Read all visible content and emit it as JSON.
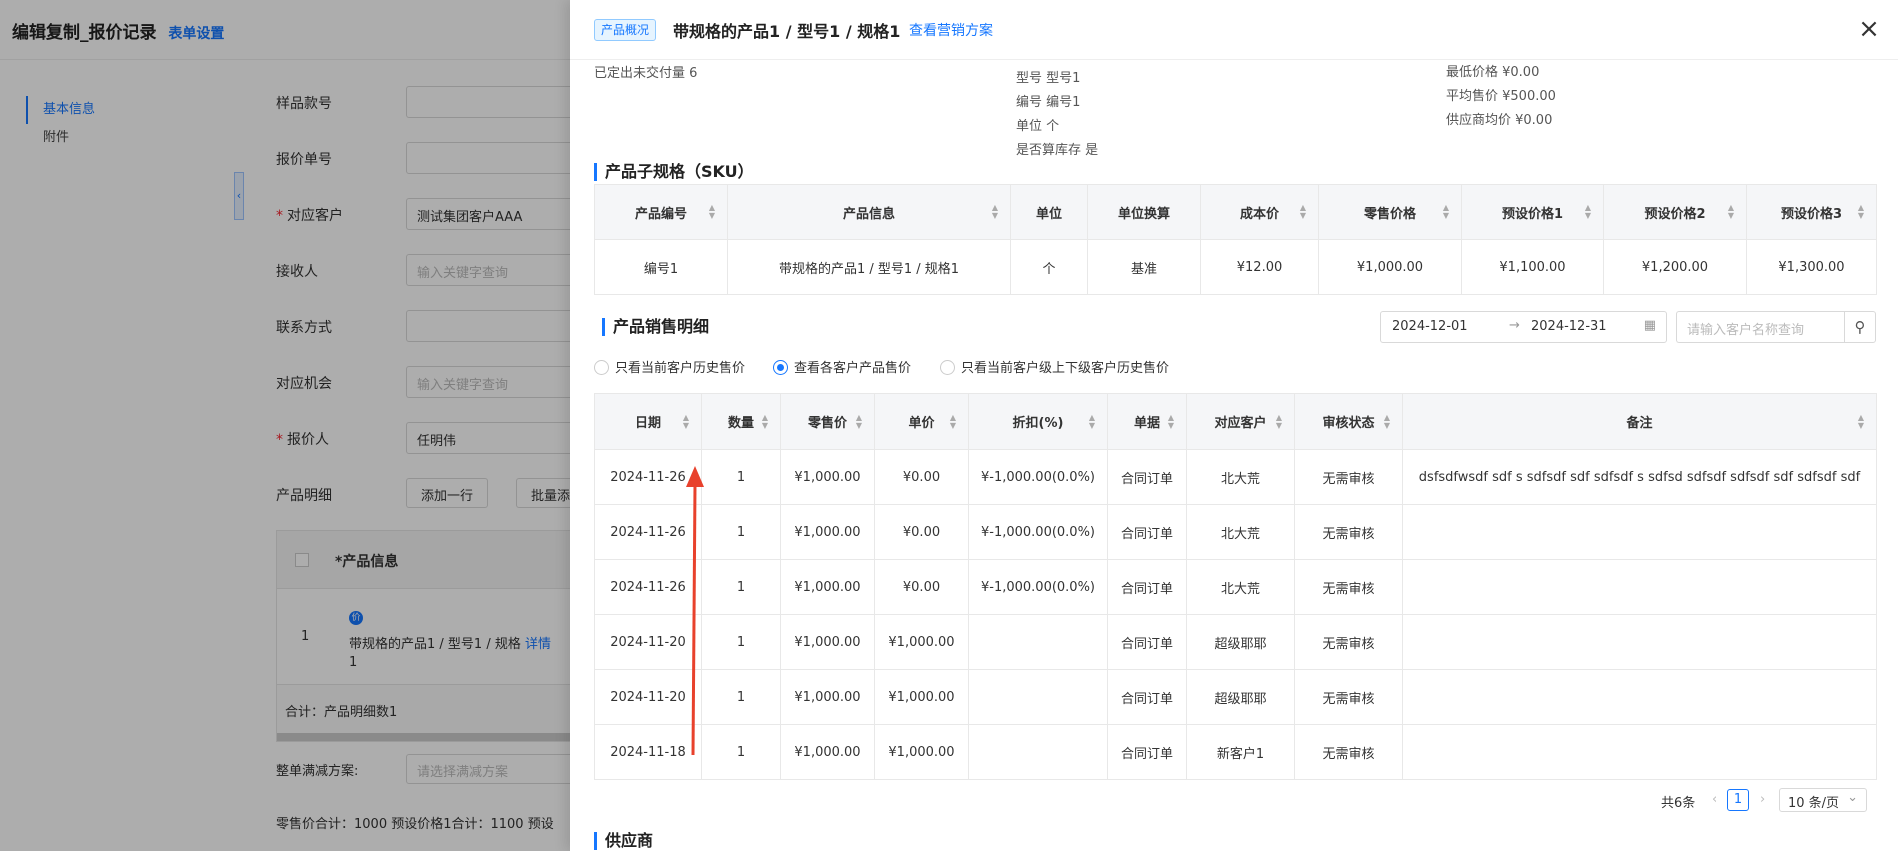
{
  "bg": {
    "title": "编辑复制_报价记录",
    "setting": "表单设置",
    "nav": [
      "基本信息",
      "附件"
    ],
    "collapse_glyph": "‹",
    "fields": [
      {
        "label": "样品款号",
        "required": false,
        "value": "",
        "placeholder": ""
      },
      {
        "label": "报价单号",
        "required": false,
        "value": "",
        "placeholder": ""
      },
      {
        "label": "对应客户",
        "required": true,
        "value": "测试集团客户AAA",
        "placeholder": ""
      },
      {
        "label": "接收人",
        "required": false,
        "value": "",
        "placeholder": "输入关键字查询"
      },
      {
        "label": "联系方式",
        "required": false,
        "value": "",
        "placeholder": ""
      },
      {
        "label": "对应机会",
        "required": false,
        "value": "",
        "placeholder": "输入关键字查询"
      },
      {
        "label": "报价人",
        "required": true,
        "value": "任明伟",
        "placeholder": ""
      }
    ],
    "required_mark": "*",
    "product_detail_label": "产品明细",
    "add_row": "添加一行",
    "batch_add": "批量添加",
    "table_header": "*产品信息",
    "row_no": "1",
    "price_badge": "价",
    "row_product": "带规格的产品1 / 型号1 / 规格",
    "row_detail_link": "详情",
    "row_qty": "1",
    "sum_text": "合计：产品明细数1",
    "discount_label": "整单满减方案:",
    "discount_placeholder": "请选择满减方案",
    "totals": "零售价合计：1000  预设价格1合计：1100  预设"
  },
  "drawer": {
    "tag": "产品概况",
    "title": "带规格的产品1 / 型号1 / 规格1",
    "marketing_link": "查看营销方案",
    "close_glyph": "×",
    "info": {
      "undelivered": "已定出未交付量  6",
      "model": "型号 型号1",
      "code": "编号 编号1",
      "unit": "单位 个",
      "stock": "是否算库存 是",
      "min_price": "最低价格 ¥0.00",
      "avg_price": "平均售价 ¥500.00",
      "supplier_avg": "供应商均价 ¥0.00"
    },
    "sku_title": "产品子规格（SKU）",
    "sku_headers": [
      "产品编号",
      "产品信息",
      "单位",
      "单位换算",
      "成本价",
      "零售价格",
      "预设价格1",
      "预设价格2",
      "预设价格3"
    ],
    "sku_row": [
      "编号1",
      "带规格的产品1 / 型号1 / 规格1",
      "个",
      "基准",
      "¥12.00",
      "¥1,000.00",
      "¥1,100.00",
      "¥1,200.00",
      "¥1,300.00"
    ],
    "sales_title": "产品销售明细",
    "date_start": "2024-12-01",
    "date_arrow": "→",
    "date_end": "2024-12-31",
    "calendar_glyph": "▦",
    "search_placeholder": "请输入客户名称查询",
    "search_glyph": "⚲",
    "radios": [
      {
        "label": "只看当前客户历史售价",
        "checked": false
      },
      {
        "label": "查看各客户产品售价",
        "checked": true
      },
      {
        "label": "只看当前客户级上下级客户历史售价",
        "checked": false
      }
    ],
    "sales_headers": [
      "日期",
      "数量",
      "零售价",
      "单价",
      "折扣(%)",
      "单据",
      "对应客户",
      "审核状态",
      "备注"
    ],
    "sales_rows": [
      [
        "2024-11-26",
        "1",
        "¥1,000.00",
        "¥0.00",
        "¥-1,000.00(0.0%)",
        "合同订单",
        "北大荒",
        "无需审核",
        "dsfsdfwsdf sdf s sdfsdf sdf sdfsdf s sdfsd sdfsdf sdfsdf sdf sdfsdf sdf"
      ],
      [
        "2024-11-26",
        "1",
        "¥1,000.00",
        "¥0.00",
        "¥-1,000.00(0.0%)",
        "合同订单",
        "北大荒",
        "无需审核",
        ""
      ],
      [
        "2024-11-26",
        "1",
        "¥1,000.00",
        "¥0.00",
        "¥-1,000.00(0.0%)",
        "合同订单",
        "北大荒",
        "无需审核",
        ""
      ],
      [
        "2024-11-20",
        "1",
        "¥1,000.00",
        "¥1,000.00",
        "",
        "合同订单",
        "超级耶耶",
        "无需审核",
        ""
      ],
      [
        "2024-11-20",
        "1",
        "¥1,000.00",
        "¥1,000.00",
        "",
        "合同订单",
        "超级耶耶",
        "无需审核",
        ""
      ],
      [
        "2024-11-18",
        "1",
        "¥1,000.00",
        "¥1,000.00",
        "",
        "合同订单",
        "新客户1",
        "无需审核",
        ""
      ]
    ],
    "pager": {
      "total": "共6条",
      "prev": "‹",
      "page": "1",
      "next": "›",
      "size": "10 条/页",
      "size_arrow": "⌄"
    },
    "supplier_title": "供应商"
  },
  "colors": {
    "accent": "#1677ff",
    "annotation_arrow": "#e8412c"
  }
}
